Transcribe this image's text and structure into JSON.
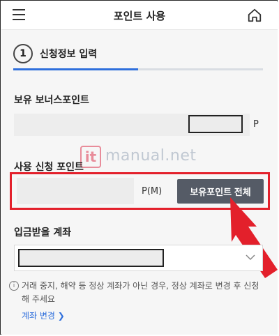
{
  "header": {
    "title": "포인트 사용",
    "menu_icon": "hamburger-icon",
    "home_icon": "home-icon"
  },
  "step": {
    "number": "1",
    "label": "신청정보 입력",
    "progress": 0.5
  },
  "bonus_points": {
    "label": "보유 보너스포인트",
    "unit": "P"
  },
  "watermark": {
    "badge": "it",
    "text": "manual.net"
  },
  "use_points": {
    "label": "사용 신청 포인트",
    "unit": "P(M)",
    "all_button": "보유포인트 전체"
  },
  "deposit_account": {
    "label": "입금받을 계좌"
  },
  "notice": {
    "text": "거래 중지, 해약 등 정상 계좌가 아닌 경우, 정상 계좌로 변경 후 신청해 주세요",
    "link": "계좌 변경 ❯"
  },
  "colors": {
    "accent": "#2f6fdc",
    "highlight": "#e3202b",
    "button": "#555b66"
  }
}
